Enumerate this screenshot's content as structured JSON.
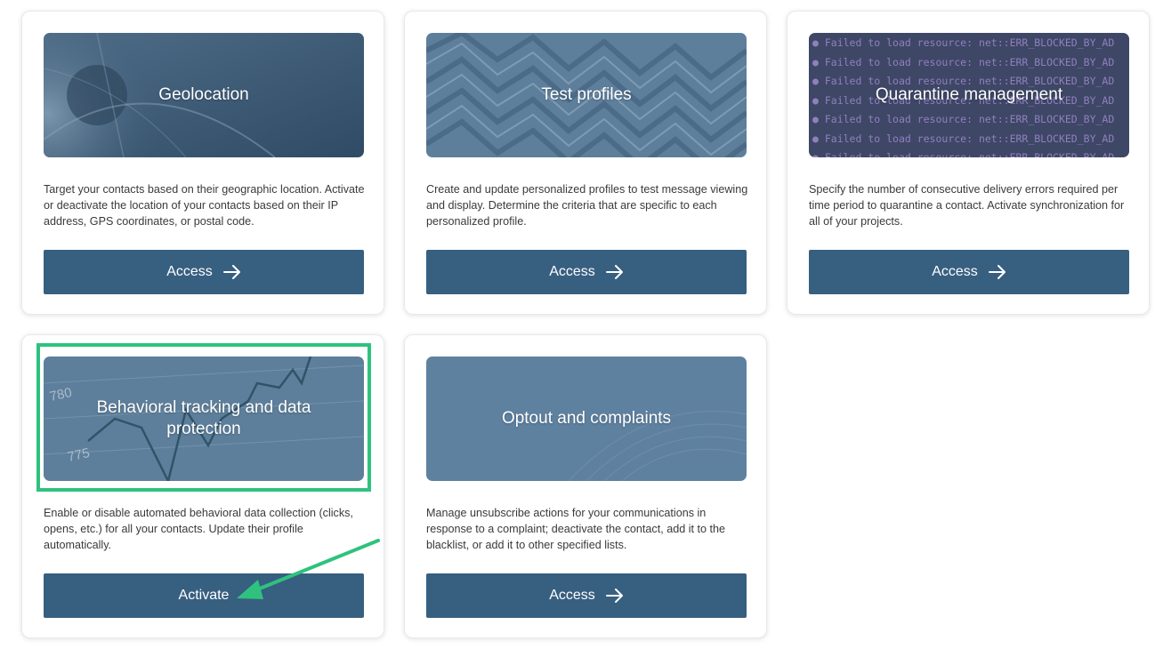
{
  "cards": [
    {
      "title": "Geolocation",
      "description": "Target your contacts based on their geographic location. Activate or deactivate the location of your contacts based on their IP address, GPS coordinates, or postal code.",
      "button_label": "Access",
      "button_icon": "arrow-right-icon"
    },
    {
      "title": "Test profiles",
      "description": "Create and update personalized profiles to test message viewing and display. Determine the criteria that are specific to each personalized profile.",
      "button_label": "Access",
      "button_icon": "arrow-right-icon"
    },
    {
      "title": "Quarantine management",
      "description": "Specify the number of consecutive delivery errors required per time period to quarantine a contact. Activate synchronization for all of your projects.",
      "button_label": "Access",
      "button_icon": "arrow-right-icon",
      "banner_text_line": "Failed to load resource: net::ERR_BLOCKED_BY_AD"
    },
    {
      "title": "Behavioral tracking and data protection",
      "description": "Enable or disable automated behavioral data collection (clicks, opens, etc.) for all your contacts. Update their profile automatically.",
      "button_label": "Activate",
      "banner_labels": [
        "780",
        "775"
      ]
    },
    {
      "title": "Optout and complaints",
      "description": "Manage unsubscribe actions for your communications in response to a complaint; deactivate the contact, add it to the blacklist, or add it to other specified lists.",
      "button_label": "Access",
      "button_icon": "arrow-right-icon"
    }
  ],
  "colors": {
    "button": "#375f80",
    "highlight": "#2ec27e",
    "text": "#3a3a3a"
  }
}
